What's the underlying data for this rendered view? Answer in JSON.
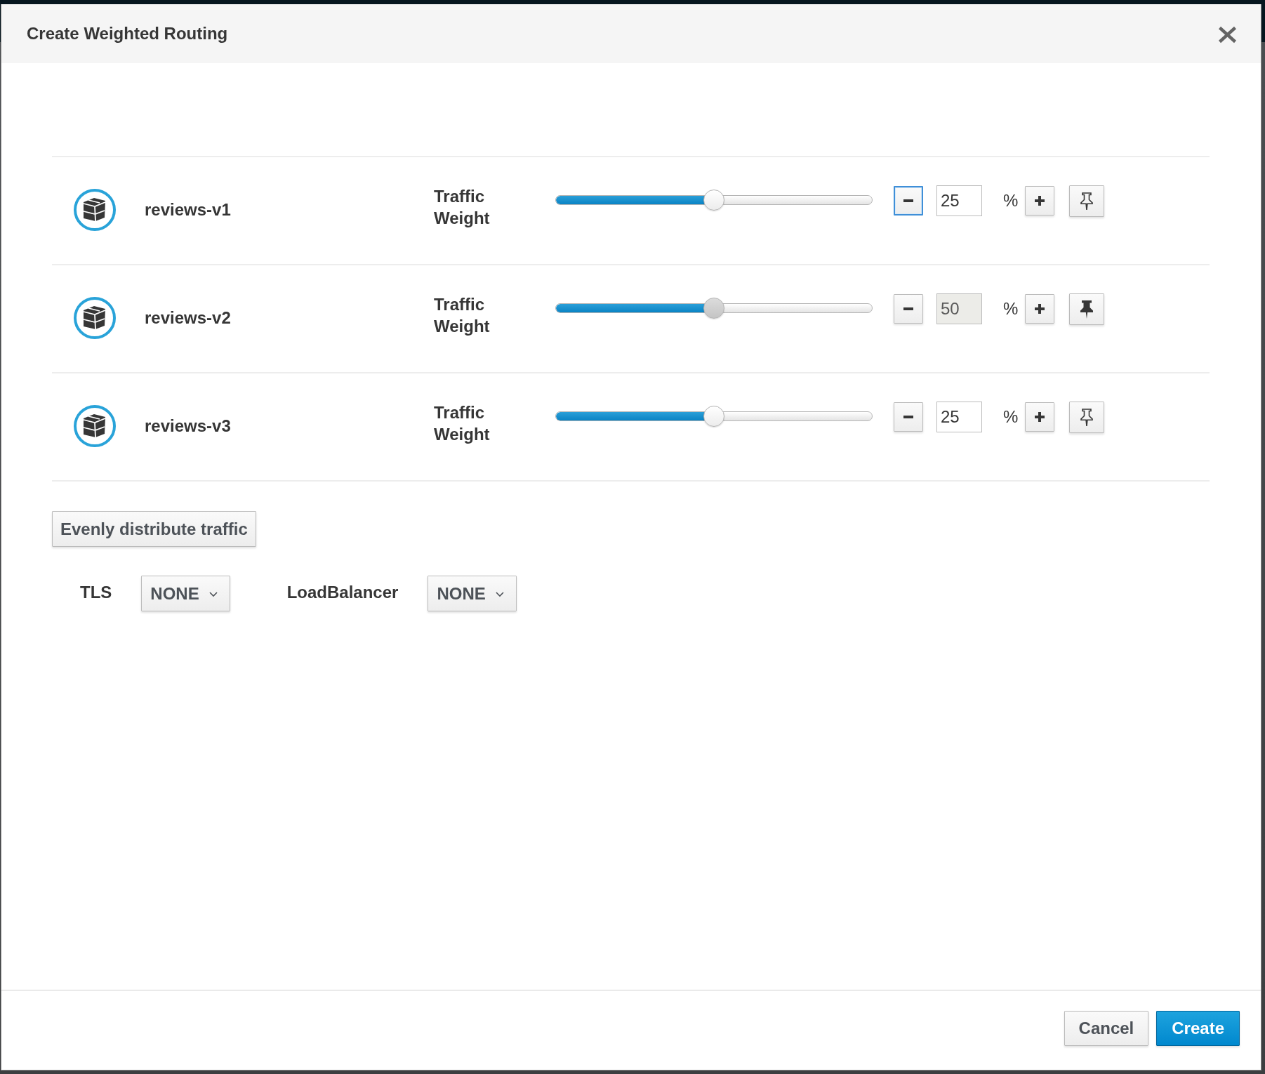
{
  "dialog": {
    "title": "Create Weighted Routing"
  },
  "routes": [
    {
      "name": "reviews-v1",
      "weight_label": "Traffic Weight",
      "level": 0.5,
      "value": "25",
      "unit": "%",
      "pinned": false,
      "minus_focused": true
    },
    {
      "name": "reviews-v2",
      "weight_label": "Traffic Weight",
      "level": 0.5,
      "value": "50",
      "unit": "%",
      "pinned": true,
      "minus_focused": false
    },
    {
      "name": "reviews-v3",
      "weight_label": "Traffic Weight",
      "level": 0.5,
      "value": "25",
      "unit": "%",
      "pinned": false,
      "minus_focused": false
    }
  ],
  "distribute_button": {
    "label": "Evenly distribute traffic"
  },
  "settings": [
    {
      "label": "TLS",
      "value": "NONE"
    },
    {
      "label": "LoadBalancer",
      "value": "NONE"
    }
  ],
  "footer_buttons": [
    {
      "label": "Cancel",
      "kind": "secondary"
    },
    {
      "label": "Create",
      "kind": "primary"
    }
  ]
}
